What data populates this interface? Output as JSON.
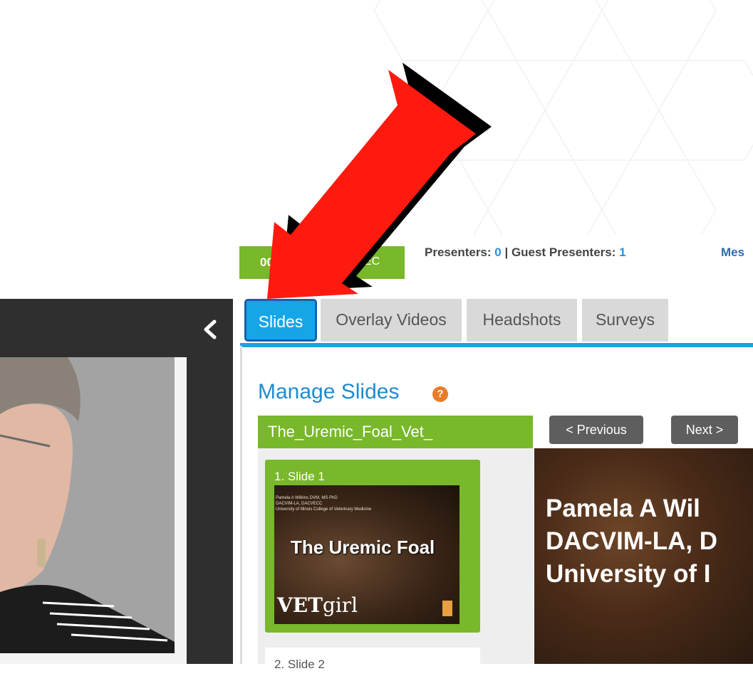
{
  "timer": {
    "prefix": "00:",
    "suffix": "EC"
  },
  "presenters": {
    "label1": "Presenters: ",
    "count1": "0",
    "sep": " | Guest Presenters: ",
    "count2": "1"
  },
  "messages_label": "Mes",
  "tabs": [
    "Slides",
    "Overlay Videos",
    "Headshots",
    "Surveys"
  ],
  "manage": {
    "title": "Manage Slides",
    "help_icon": "?"
  },
  "file_name": "The_Uremic_Foal_Vet_",
  "nav": {
    "previous": "< Previous",
    "next": "Next >"
  },
  "slides": [
    {
      "label": "1. Slide 1",
      "thumb_small": [
        "Pamela A Wilkins DVM, MS PhD",
        "DACVIM-LA, DACVECC",
        "University of Illinois College of Veterinary Medicine"
      ],
      "thumb_title": "The Uremic Foal",
      "logo": {
        "bold": "VET",
        "rest": "girl"
      }
    },
    {
      "label": "2. Slide 2"
    }
  ],
  "preview_lines": [
    "Pamela A Wil",
    "DACVIM-LA, D",
    "University of I"
  ],
  "colors": {
    "green": "#78b82a",
    "tab_active": "#16a6e8",
    "accent_blue": "#1aa2e6",
    "help_orange": "#e77d2a",
    "arrow_red": "#ff0000"
  }
}
